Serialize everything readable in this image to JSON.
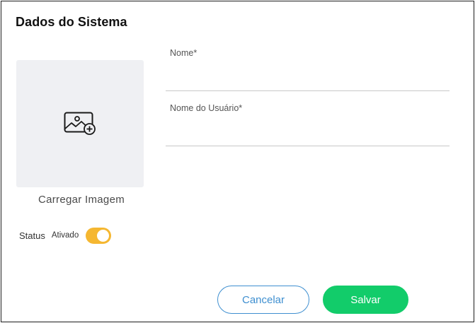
{
  "dialog": {
    "title": "Dados do Sistema"
  },
  "image_upload": {
    "icon": "image-add-icon",
    "label": "Carregar Imagem"
  },
  "status": {
    "label": "Status",
    "value": "Ativado",
    "enabled": true
  },
  "fields": {
    "name": {
      "label": "Nome*",
      "value": ""
    },
    "username": {
      "label": "Nome do Usuário*",
      "value": ""
    }
  },
  "actions": {
    "cancel_label": "Cancelar",
    "save_label": "Salvar"
  },
  "colors": {
    "toggle_on": "#f5b731",
    "cancel_border": "#3e8fd0",
    "save_bg": "#12cc6a",
    "upload_bg": "#eff0f3"
  }
}
